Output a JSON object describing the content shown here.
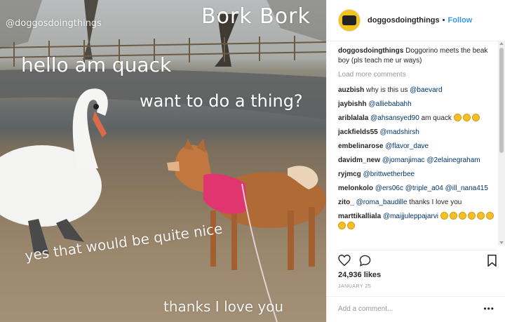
{
  "photo": {
    "watermark": "@doggosdoingthings",
    "captions": {
      "bork": "Bork Bork",
      "hello": "hello am quack",
      "want": "want to do a thing?",
      "yes": "yes that would be quite nice",
      "thanks": "thanks I love you"
    }
  },
  "post": {
    "username": "doggosdoingthings",
    "separator": "•",
    "follow_label": "Follow",
    "caption": {
      "user": "doggosdoingthings",
      "text": "Doggorino meets the beak boy (pls teach me ur ways)"
    },
    "load_more": "Load more comments",
    "comments": [
      {
        "user": "auzbish",
        "text": "why is this us ",
        "mention": "@baevard"
      },
      {
        "user": "jaybishh",
        "text": "",
        "mention": "@alliebabahh"
      },
      {
        "user": "ariblalala",
        "text": "",
        "mention": "@ahsansyed90",
        "after": " am quack ",
        "emoji_count": 3
      },
      {
        "user": "jackfields55",
        "text": "",
        "mention": "@madshirsh"
      },
      {
        "user": "embelinarose",
        "text": "",
        "mention": "@flavor_dave"
      },
      {
        "user": "davidm_new",
        "text": "",
        "mention": "@jomanjimac",
        "mention2": "@2elainegraham"
      },
      {
        "user": "ryjmcg",
        "text": "",
        "mention": "@brittwetherbee"
      },
      {
        "user": "melonkolo",
        "text": "",
        "mention": "@ers06c",
        "mention2": "@triple_a04",
        "mention3": "@ill_nana415"
      },
      {
        "user": "zito_",
        "text": "",
        "mention": "@roma_baudille",
        "after": " thanks I love you"
      },
      {
        "user": "marttikalliala",
        "text": "",
        "mention": "@maijjuleppajarvi",
        "emoji_count": 8
      }
    ],
    "likes": "24,936 likes",
    "date": "JANUARY 25",
    "add_comment_placeholder": "Add a comment...",
    "more_label": "•••"
  },
  "icons": {
    "heart": "heart-icon",
    "comment": "comment-icon",
    "bookmark": "bookmark-icon",
    "avatar": "profile-avatar",
    "emoji": "laughing-crying-emoji"
  }
}
